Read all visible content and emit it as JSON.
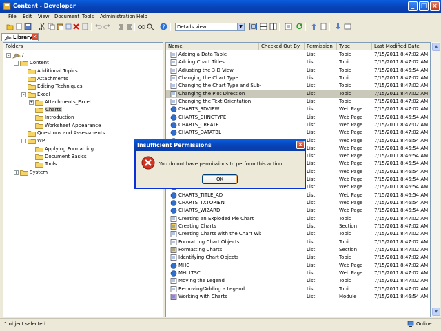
{
  "window": {
    "title": "Content - Developer"
  },
  "menu": [
    "File",
    "Edit",
    "View",
    "Document",
    "Tools",
    "Administration",
    "Help"
  ],
  "toolbar": {
    "view_selector": "Details view"
  },
  "tab": {
    "label": "Library"
  },
  "folders": {
    "header": "Folders",
    "tree": [
      {
        "label": "/",
        "expander": "-"
      },
      {
        "label": "Content",
        "expander": "-"
      },
      {
        "label": "Additional Topics",
        "expander": ""
      },
      {
        "label": "Attachments",
        "expander": ""
      },
      {
        "label": "Editing Techniques",
        "expander": ""
      },
      {
        "label": "Excel",
        "expander": "-"
      },
      {
        "label": "Attachments_Excel",
        "expander": "+"
      },
      {
        "label": "Charts",
        "expander": "",
        "selected": true
      },
      {
        "label": "Introduction",
        "expander": ""
      },
      {
        "label": "Worksheet Appearance",
        "expander": ""
      },
      {
        "label": "Questions and Assessments",
        "expander": ""
      },
      {
        "label": "WP",
        "expander": "-"
      },
      {
        "label": "Applying Formatting",
        "expander": ""
      },
      {
        "label": "Document Basics",
        "expander": ""
      },
      {
        "label": "Tools",
        "expander": ""
      },
      {
        "label": "System",
        "expander": "+"
      }
    ]
  },
  "list": {
    "columns": [
      "Name",
      "Checked Out By",
      "Permission",
      "Type",
      "Last Modified Date"
    ],
    "rows": [
      {
        "name": "Adding a Data Table",
        "checked_out_by": "",
        "permission": "List",
        "type": "Topic",
        "modified": "7/15/2011 8:47:02 AM"
      },
      {
        "name": "Adding Chart Titles",
        "checked_out_by": "",
        "permission": "List",
        "type": "Topic",
        "modified": "7/15/2011 8:47:02 AM"
      },
      {
        "name": "Adjusting the 3-D View",
        "checked_out_by": "",
        "permission": "List",
        "type": "Topic",
        "modified": "7/15/2011 8:46:54 AM"
      },
      {
        "name": "Changing the Chart Type",
        "checked_out_by": "",
        "permission": "List",
        "type": "Topic",
        "modified": "7/15/2011 8:47:02 AM"
      },
      {
        "name": "Changing the Chart Type and Sub-t...",
        "checked_out_by": "",
        "permission": "List",
        "type": "Topic",
        "modified": "7/15/2011 8:47:02 AM"
      },
      {
        "name": "Changing the Plot Direction",
        "checked_out_by": "",
        "permission": "List",
        "type": "Topic",
        "modified": "7/15/2011 8:47:02 AM",
        "selected": true
      },
      {
        "name": "Changing the Text Orientation",
        "checked_out_by": "",
        "permission": "List",
        "type": "Topic",
        "modified": "7/15/2011 8:47:02 AM"
      },
      {
        "name": "CHARTS_3DVIEW",
        "checked_out_by": "",
        "permission": "List",
        "type": "Web Page",
        "modified": "7/15/2011 8:47:02 AM"
      },
      {
        "name": "CHARTS_CHNGTYPE",
        "checked_out_by": "",
        "permission": "List",
        "type": "Web Page",
        "modified": "7/15/2011 8:46:54 AM"
      },
      {
        "name": "CHARTS_CREATE",
        "checked_out_by": "",
        "permission": "List",
        "type": "Web Page",
        "modified": "7/15/2011 8:47:02 AM"
      },
      {
        "name": "CHARTS_DATATBL",
        "checked_out_by": "",
        "permission": "List",
        "type": "Web Page",
        "modified": "7/15/2011 8:47:02 AM"
      },
      {
        "name": "",
        "checked_out_by": "",
        "permission": "List",
        "type": "Web Page",
        "modified": "7/15/2011 8:46:54 AM"
      },
      {
        "name": "",
        "checked_out_by": "",
        "permission": "List",
        "type": "Web Page",
        "modified": "7/15/2011 8:46:54 AM"
      },
      {
        "name": "",
        "checked_out_by": "",
        "permission": "List",
        "type": "Web Page",
        "modified": "7/15/2011 8:46:54 AM"
      },
      {
        "name": "",
        "checked_out_by": "",
        "permission": "List",
        "type": "Web Page",
        "modified": "7/15/2011 8:46:54 AM"
      },
      {
        "name": "",
        "checked_out_by": "",
        "permission": "List",
        "type": "Web Page",
        "modified": "7/15/2011 8:46:54 AM"
      },
      {
        "name": "",
        "checked_out_by": "",
        "permission": "List",
        "type": "Web Page",
        "modified": "7/15/2011 8:46:54 AM"
      },
      {
        "name": "",
        "checked_out_by": "",
        "permission": "List",
        "type": "Web Page",
        "modified": "7/15/2011 8:46:54 AM"
      },
      {
        "name": "CHARTS_TITLE_AD",
        "checked_out_by": "",
        "permission": "List",
        "type": "Web Page",
        "modified": "7/15/2011 8:46:54 AM"
      },
      {
        "name": "CHARTS_TXTORIEN",
        "checked_out_by": "",
        "permission": "List",
        "type": "Web Page",
        "modified": "7/15/2011 8:46:54 AM"
      },
      {
        "name": "CHARTS_WIZARD",
        "checked_out_by": "",
        "permission": "List",
        "type": "Web Page",
        "modified": "7/15/2011 8:46:54 AM"
      },
      {
        "name": "Creating an Exploded Pie Chart",
        "checked_out_by": "",
        "permission": "List",
        "type": "Topic",
        "modified": "7/15/2011 8:47:02 AM"
      },
      {
        "name": "Creating Charts",
        "checked_out_by": "",
        "permission": "List",
        "type": "Section",
        "modified": "7/15/2011 8:47:02 AM"
      },
      {
        "name": "Creating Charts with the Chart Wizard",
        "checked_out_by": "",
        "permission": "List",
        "type": "Topic",
        "modified": "7/15/2011 8:47:02 AM"
      },
      {
        "name": "Formatting Chart Objects",
        "checked_out_by": "",
        "permission": "List",
        "type": "Topic",
        "modified": "7/15/2011 8:47:02 AM"
      },
      {
        "name": "Formatting Charts",
        "checked_out_by": "",
        "permission": "List",
        "type": "Section",
        "modified": "7/15/2011 8:47:02 AM"
      },
      {
        "name": "Identifying Chart Objects",
        "checked_out_by": "",
        "permission": "List",
        "type": "Topic",
        "modified": "7/15/2011 8:47:02 AM"
      },
      {
        "name": "MHC",
        "checked_out_by": "",
        "permission": "List",
        "type": "Web Page",
        "modified": "7/15/2011 8:47:02 AM"
      },
      {
        "name": "MHLLTSC",
        "checked_out_by": "",
        "permission": "List",
        "type": "Web Page",
        "modified": "7/15/2011 8:47:02 AM"
      },
      {
        "name": "Moving the Legend",
        "checked_out_by": "",
        "permission": "List",
        "type": "Topic",
        "modified": "7/15/2011 8:47:02 AM"
      },
      {
        "name": "Removing/Adding a Legend",
        "checked_out_by": "",
        "permission": "List",
        "type": "Topic",
        "modified": "7/15/2011 8:47:02 AM"
      },
      {
        "name": "Working with Charts",
        "checked_out_by": "",
        "permission": "List",
        "type": "Module",
        "modified": "7/15/2011 8:46:54 AM"
      }
    ]
  },
  "dialog": {
    "title": "Insufficient Permissions",
    "message": "You do not have permissions to perform this action.",
    "ok_label": "OK",
    "icon": "error-icon"
  },
  "status": {
    "text": "1 object selected",
    "connection": "Online"
  },
  "colors": {
    "title_blue": "#0a5ddd",
    "selection_gray": "#cac8b8",
    "error_red": "#d4341f"
  }
}
